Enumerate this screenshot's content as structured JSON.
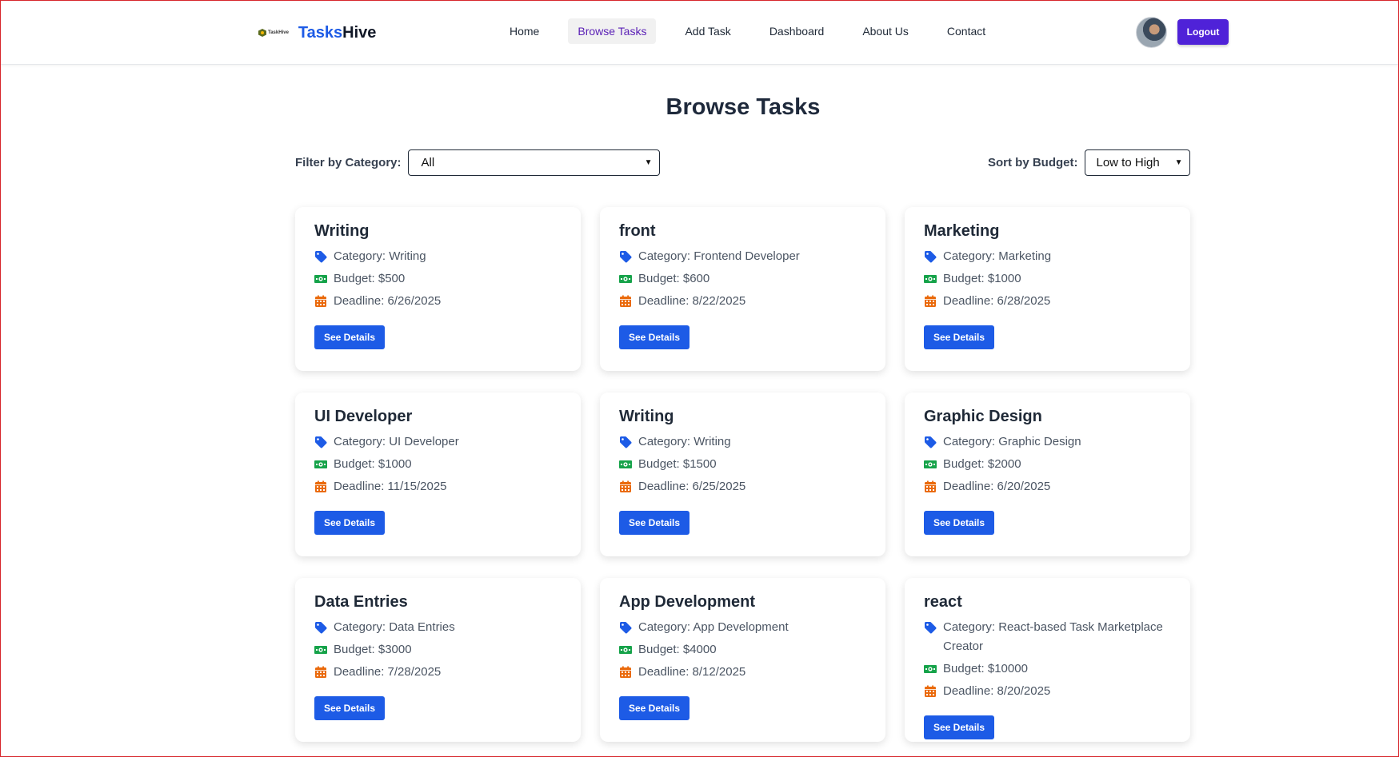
{
  "nav": {
    "logo_text": "TaskHive",
    "brand_part1": "Tasks",
    "brand_part2": "Hive",
    "links": [
      {
        "label": "Home",
        "active": false
      },
      {
        "label": "Browse Tasks",
        "active": true
      },
      {
        "label": "Add Task",
        "active": false
      },
      {
        "label": "Dashboard",
        "active": false
      },
      {
        "label": "About Us",
        "active": false
      },
      {
        "label": "Contact",
        "active": false
      }
    ],
    "logout_label": "Logout"
  },
  "page": {
    "title": "Browse Tasks",
    "filter": {
      "label": "Filter by Category:",
      "selected": "All"
    },
    "sort": {
      "label": "Sort by Budget:",
      "selected": "Low to High"
    }
  },
  "colors": {
    "brand_blue": "#1d5be6",
    "logout_purple": "#4f22d8",
    "tag_icon": "#1d5be6",
    "money_icon": "#16a34a",
    "calendar_icon": "#ea6a0c"
  },
  "icons": {
    "category": "tag-icon",
    "budget": "money-icon",
    "deadline": "calendar-icon"
  },
  "tasks": [
    {
      "title": "Writing",
      "category": "Category: Writing",
      "budget": "Budget: $500",
      "deadline": "Deadline: 6/26/2025",
      "button": "See Details"
    },
    {
      "title": "front",
      "category": "Category: Frontend Developer",
      "budget": "Budget: $600",
      "deadline": "Deadline: 8/22/2025",
      "button": "See Details"
    },
    {
      "title": "Marketing",
      "category": "Category: Marketing",
      "budget": "Budget: $1000",
      "deadline": "Deadline: 6/28/2025",
      "button": "See Details"
    },
    {
      "title": "UI Developer",
      "category": "Category: UI Developer",
      "budget": "Budget: $1000",
      "deadline": "Deadline: 11/15/2025",
      "button": "See Details"
    },
    {
      "title": "Writing",
      "category": "Category: Writing",
      "budget": "Budget: $1500",
      "deadline": "Deadline: 6/25/2025",
      "button": "See Details"
    },
    {
      "title": "Graphic Design",
      "category": "Category: Graphic Design",
      "budget": "Budget: $2000",
      "deadline": "Deadline: 6/20/2025",
      "button": "See Details"
    },
    {
      "title": "Data Entries",
      "category": "Category: Data Entries",
      "budget": "Budget: $3000",
      "deadline": "Deadline: 7/28/2025",
      "button": "See Details"
    },
    {
      "title": "App Development",
      "category": "Category: App Development",
      "budget": "Budget: $4000",
      "deadline": "Deadline: 8/12/2025",
      "button": "See Details"
    },
    {
      "title": "react",
      "category": "Category: React-based Task Marketplace Creator",
      "budget": "Budget: $10000",
      "deadline": "Deadline: 8/20/2025",
      "button": "See Details"
    }
  ]
}
